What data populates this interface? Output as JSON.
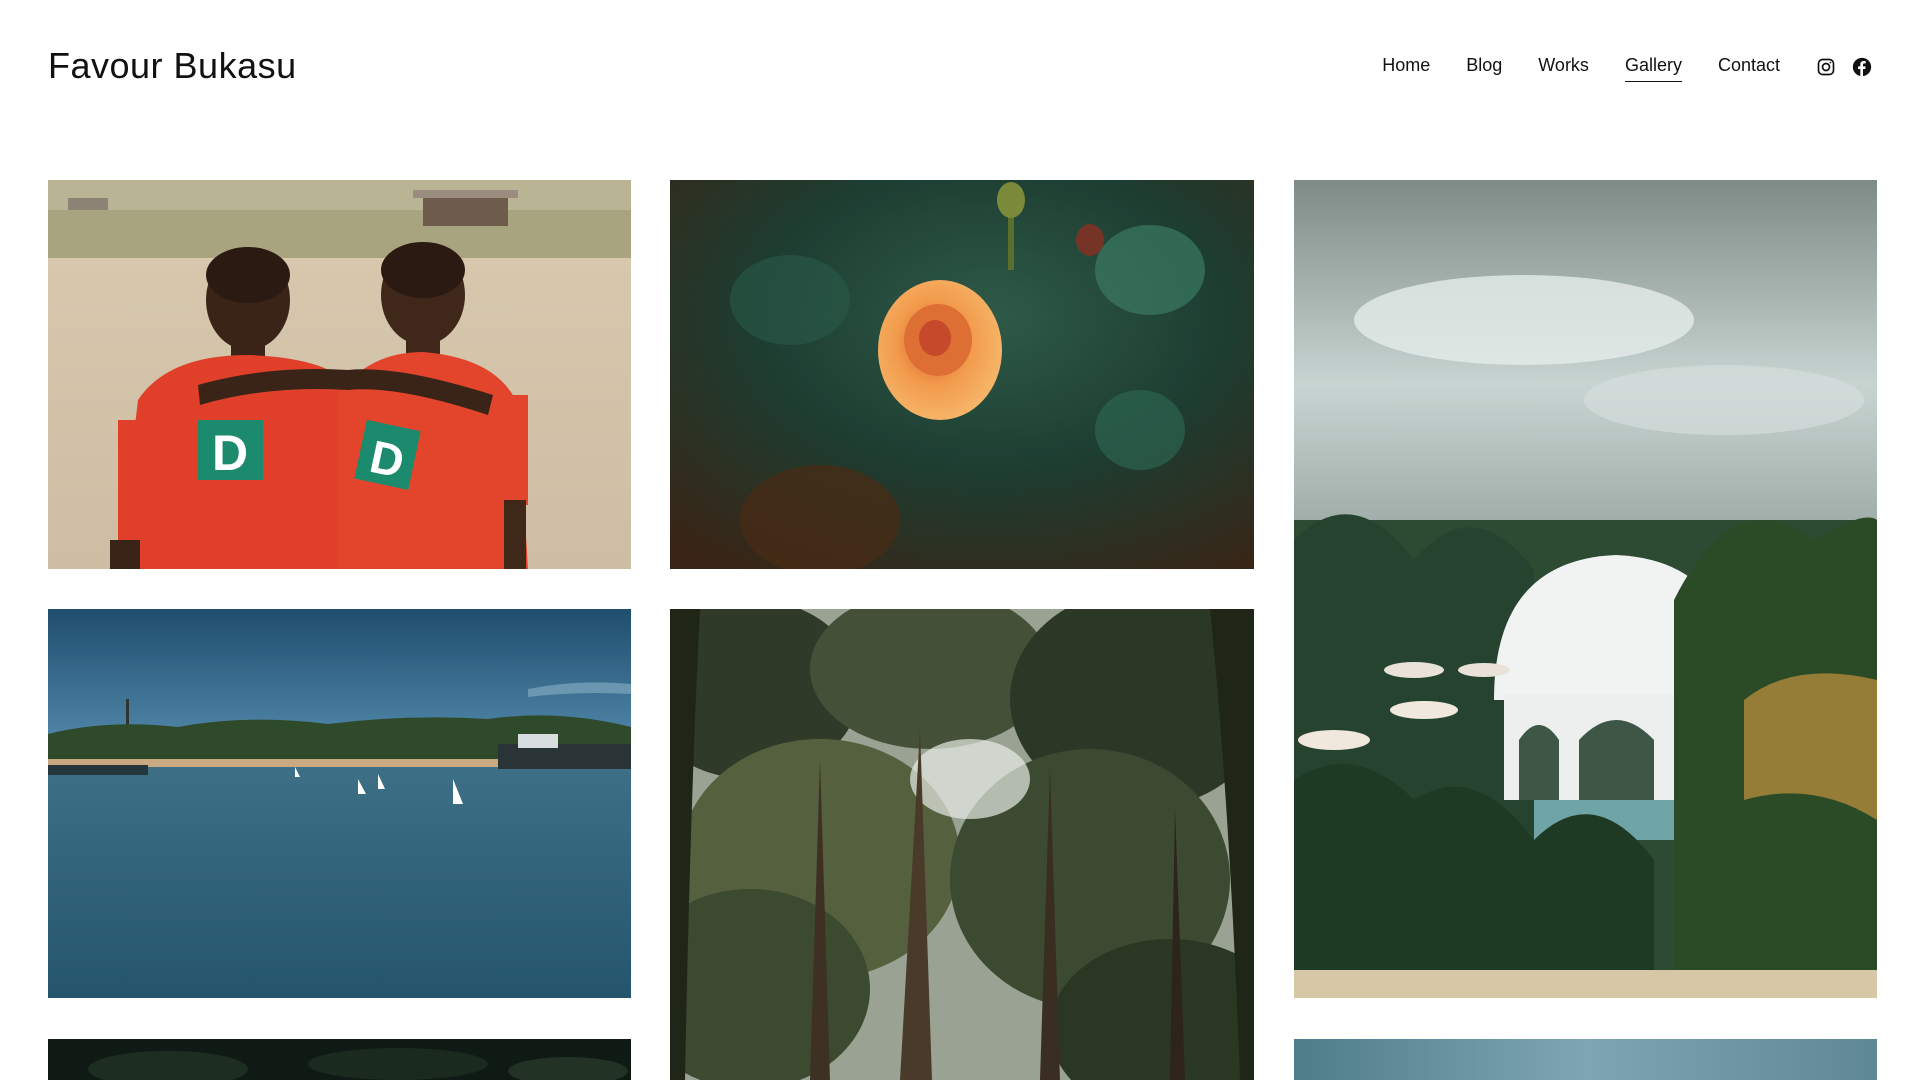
{
  "site": {
    "title": "Favour Bukasu"
  },
  "nav": {
    "items": [
      "Home",
      "Blog",
      "Works",
      "Gallery",
      "Contact"
    ],
    "active": "Gallery"
  },
  "social": {
    "icons": [
      "instagram-icon",
      "facebook-icon"
    ]
  },
  "gallery": {
    "photos": [
      "two-boys-in-red-jerseys",
      "orange-rose",
      "white-dome-resort-with-palms",
      "harbor-with-sailboats",
      "forest-canopy",
      "dark-foliage",
      "coastline-sky"
    ]
  },
  "colors": {
    "text": "#111111",
    "background": "#ffffff"
  }
}
